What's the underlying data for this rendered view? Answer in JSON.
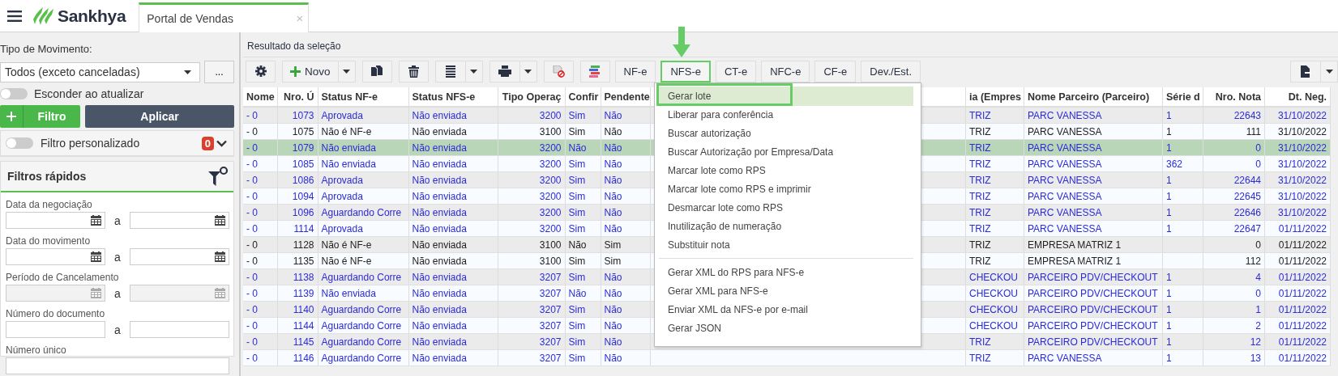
{
  "header": {
    "brand": "Sankhya",
    "tab": {
      "title": "Portal de Vendas",
      "close": "×",
      "selected": true
    }
  },
  "left_panel": {
    "movement_type": {
      "label": "Tipo de Movimento:",
      "value": "Todos (exceto canceladas)",
      "more": "..."
    },
    "hide_on_refresh": {
      "label": "Esconder ao atualizar",
      "on": false
    },
    "filter_button": "Filtro",
    "apply_button": "Aplicar",
    "custom_filter": {
      "label": "Filtro personalizado",
      "on": false,
      "count": "0"
    },
    "quick_filters": {
      "title": "Filtros rápidos",
      "fields": [
        {
          "label": "Data da negociação",
          "kind": "date-range",
          "separator": "a",
          "disabled": false
        },
        {
          "label": "Data do movimento",
          "kind": "date-range",
          "separator": "a",
          "disabled": false
        },
        {
          "label": "Período de Cancelamento",
          "kind": "date-range",
          "separator": "a",
          "disabled": true
        },
        {
          "label": "Número do documento",
          "kind": "range",
          "separator": "a",
          "disabled": false
        },
        {
          "label": "Número único",
          "kind": "single",
          "disabled": false
        }
      ]
    }
  },
  "results": {
    "title": "Resultado da seleção",
    "new_button": "Novo",
    "doc_buttons": [
      {
        "label": "NF-e",
        "selected": false
      },
      {
        "label": "NFS-e",
        "selected": true
      },
      {
        "label": "CT-e",
        "selected": false
      },
      {
        "label": "NFC-e",
        "selected": false
      },
      {
        "label": "CF-e",
        "selected": false
      },
      {
        "label": "Dev./Est.",
        "selected": false
      }
    ],
    "table": {
      "columns": [
        "Nome",
        "Nro. Ú",
        "Status NF-e",
        "Status NFS-e",
        "Tipo Operaç",
        "Confir",
        "Pendente",
        "ia (Empres",
        "Nome Parceiro (Parceiro)",
        "Série d",
        "Nro. Nota",
        "Dt. Neg."
      ],
      "rows": [
        {
          "color": "#2b2bd9",
          "selected": false,
          "cells": [
            "- 0",
            "1073",
            "Aprovada",
            "Não enviada",
            "3200",
            "Sim",
            "Não",
            "TRIZ",
            "PARC VANESSA",
            "1",
            "22643",
            "31/10/2022"
          ]
        },
        {
          "color": "#222222",
          "selected": false,
          "cells": [
            "- 0",
            "1075",
            "Não é NF-e",
            "Não enviada",
            "3100",
            "Sim",
            "Não",
            "TRIZ",
            "PARC VANESSA",
            "1",
            "111",
            "31/10/2022"
          ]
        },
        {
          "color": "#2b2bd9",
          "selected": true,
          "cells": [
            "- 0",
            "1079",
            "Não enviada",
            "Não enviada",
            "3200",
            "Não",
            "Não",
            "TRIZ",
            "PARC VANESSA",
            "1",
            "0",
            "31/10/2022"
          ]
        },
        {
          "color": "#2b2bd9",
          "selected": false,
          "cells": [
            "- 0",
            "1085",
            "Não enviada",
            "Não enviada",
            "3200",
            "Sim",
            "Não",
            "TRIZ",
            "PARC VANESSA",
            "362",
            "0",
            "31/10/2022"
          ]
        },
        {
          "color": "#2b2bd9",
          "selected": false,
          "cells": [
            "- 0",
            "1086",
            "Aprovada",
            "Não enviada",
            "3200",
            "Sim",
            "Não",
            "TRIZ",
            "PARC VANESSA",
            "1",
            "22644",
            "31/10/2022"
          ]
        },
        {
          "color": "#2b2bd9",
          "selected": false,
          "cells": [
            "- 0",
            "1094",
            "Aprovada",
            "Não enviada",
            "3200",
            "Sim",
            "Não",
            "TRIZ",
            "PARC VANESSA",
            "1",
            "22645",
            "31/10/2022"
          ]
        },
        {
          "color": "#2b2bd9",
          "selected": false,
          "cells": [
            "- 0",
            "1096",
            "Aguardando Corre",
            "Não enviada",
            "3200",
            "Sim",
            "Não",
            "TRIZ",
            "PARC VANESSA",
            "1",
            "22646",
            "31/10/2022"
          ]
        },
        {
          "color": "#2b2bd9",
          "selected": false,
          "cells": [
            "- 0",
            "1114",
            "Aprovada",
            "Não enviada",
            "3200",
            "Sim",
            "Não",
            "TRIZ",
            "PARC VANESSA",
            "1",
            "22647",
            "01/11/2022"
          ]
        },
        {
          "color": "#222222",
          "selected": false,
          "cells": [
            "- 0",
            "1128",
            "Não é NF-e",
            "Não enviada",
            "3100",
            "Não",
            "Sim",
            "TRIZ",
            "EMPRESA MATRIZ 1",
            "",
            "0",
            "01/11/2022"
          ]
        },
        {
          "color": "#222222",
          "selected": false,
          "cells": [
            "- 0",
            "1135",
            "Não é NF-e",
            "Não enviada",
            "3100",
            "Sim",
            "Sim",
            "TRIZ",
            "EMPRESA MATRIZ 1",
            "",
            "112",
            "01/11/2022"
          ]
        },
        {
          "color": "#2b2bd9",
          "selected": false,
          "cells": [
            "- 0",
            "1138",
            "Aguardando Corre",
            "Não enviada",
            "3207",
            "Sim",
            "Não",
            "CHECKOU",
            "PARCEIRO PDV/CHECKOUT",
            "1",
            "4",
            "01/11/2022"
          ]
        },
        {
          "color": "#2b2bd9",
          "selected": false,
          "cells": [
            "- 0",
            "1139",
            "Não enviada",
            "Não enviada",
            "3207",
            "Não",
            "Não",
            "CHECKOU",
            "PARCEIRO PDV/CHECKOUT",
            "1",
            "0",
            "01/11/2022"
          ]
        },
        {
          "color": "#2b2bd9",
          "selected": false,
          "cells": [
            "- 0",
            "1140",
            "Aguardando Corre",
            "Não enviada",
            "3207",
            "Sim",
            "Não",
            "CHECKOU",
            "PARCEIRO PDV/CHECKOUT",
            "1",
            "1",
            "01/11/2022"
          ]
        },
        {
          "color": "#2b2bd9",
          "selected": false,
          "cells": [
            "- 0",
            "1144",
            "Aguardando Corre",
            "Não enviada",
            "3207",
            "Sim",
            "Não",
            "CHECKOU",
            "PARCEIRO PDV/CHECKOUT",
            "1",
            "2",
            "01/11/2022"
          ]
        },
        {
          "color": "#2b2bd9",
          "selected": false,
          "cells": [
            "- 0",
            "1145",
            "Aguardando Corre",
            "Não enviada",
            "3207",
            "Sim",
            "Não",
            "TRIZ",
            "PARCEIRO PDV/CHECKOUT",
            "1",
            "12",
            "01/11/2022"
          ]
        },
        {
          "color": "#2b2bd9",
          "selected": false,
          "cells": [
            "- 0",
            "1146",
            "Aguardando Corre",
            "Não enviada",
            "3207",
            "Sim",
            "Não",
            "TRIZ",
            "PARC VANESSA",
            "1",
            "13",
            "01/11/2022"
          ]
        }
      ]
    },
    "nfse_menu": {
      "groups": [
        [
          {
            "label": "Gerar lote",
            "selected": true
          },
          {
            "label": "Liberar para conferência",
            "selected": false
          },
          {
            "label": "Buscar autorização",
            "selected": false
          },
          {
            "label": "Buscar Autorização por Empresa/Data",
            "selected": false
          },
          {
            "label": "Marcar lote como RPS",
            "selected": false
          },
          {
            "label": "Marcar lote como RPS e imprimir",
            "selected": false
          },
          {
            "label": "Desmarcar lote como RPS",
            "selected": false
          },
          {
            "label": "Inutilização de numeração",
            "selected": false
          },
          {
            "label": "Substituir nota",
            "selected": false
          }
        ],
        [
          {
            "label": "Gerar XML do RPS para NFS-e",
            "selected": false
          },
          {
            "label": "Gerar XML para NFS-e",
            "selected": false
          },
          {
            "label": "Enviar XML da NFS-e por e-mail",
            "selected": false
          },
          {
            "label": "Gerar JSON",
            "selected": false
          }
        ]
      ]
    }
  }
}
